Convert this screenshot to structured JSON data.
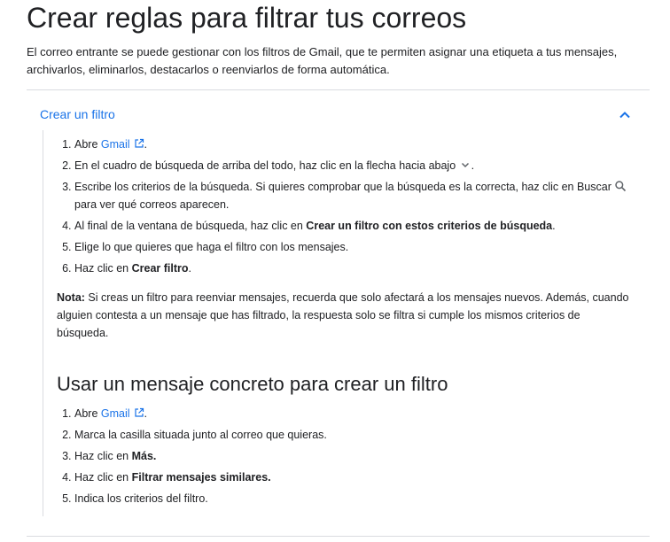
{
  "title": "Crear reglas para filtrar tus correos",
  "intro": "El correo entrante se puede gestionar con los filtros de Gmail, que te permiten asignar una etiqueta a tus mensajes, archivarlos, eliminarlos, destacarlos o reenviarlos de forma automática.",
  "section1": {
    "heading": "Crear un filtro",
    "steps": {
      "s1_pre": "Abre ",
      "s1_link": "Gmail",
      "s1_post": ".",
      "s2_pre": "En el cuadro de búsqueda de arriba del todo, haz clic en la flecha hacia abajo ",
      "s2_post": ".",
      "s3_pre": "Escribe los criterios de la búsqueda. Si quieres comprobar que la búsqueda es la correcta, haz clic en Buscar ",
      "s3_post": " para ver qué correos aparecen.",
      "s4_pre": "Al final de la ventana de búsqueda, haz clic en ",
      "s4_bold": "Crear un filtro con estos criterios de búsqueda",
      "s4_post": ".",
      "s5": "Elige lo que quieres que haga el filtro con los mensajes.",
      "s6_pre": "Haz clic en ",
      "s6_bold": "Crear filtro",
      "s6_post": "."
    },
    "note_label": "Nota:",
    "note_text": " Si creas un filtro para reenviar mensajes, recuerda que solo afectará a los mensajes nuevos. Además, cuando alguien contesta a un mensaje que has filtrado, la respuesta solo se filtra si cumple los mismos criterios de búsqueda."
  },
  "section2": {
    "heading": "Usar un mensaje concreto para crear un filtro",
    "steps": {
      "s1_pre": "Abre ",
      "s1_link": "Gmail",
      "s1_post": ".",
      "s2": "Marca la casilla situada junto al correo que quieras.",
      "s3_pre": "Haz clic en ",
      "s3_bold": "Más.",
      "s4_pre": "Haz clic en ",
      "s4_bold": "Filtrar mensajes similares.",
      "s5": "Indica los criterios del filtro."
    }
  },
  "colors": {
    "link": "#1a73e8",
    "text": "#202124",
    "divider": "#dadce0"
  },
  "icons": [
    "external-link-icon",
    "chevron-down-icon",
    "search-icon",
    "chevron-up-icon"
  ]
}
